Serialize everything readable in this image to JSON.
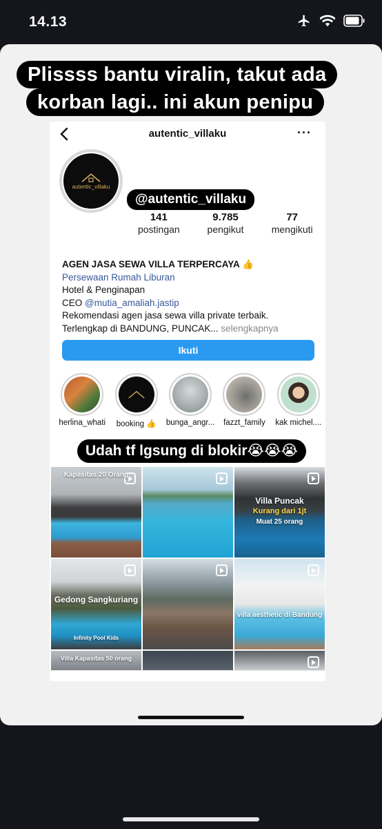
{
  "status_bar": {
    "time": "14.13",
    "icons": [
      "airplane-icon",
      "wifi-icon",
      "battery-icon"
    ]
  },
  "caption": {
    "line1": "Plissss bantu viralin, takut ada",
    "line2": "korban lagi.. ini akun penipu"
  },
  "profile": {
    "username": "autentic_villaku",
    "handle_tag": "@autentic_villaku",
    "avatar_text": "autentic_villaku",
    "stats": [
      {
        "value": "141",
        "label": "postingan"
      },
      {
        "value": "9.785",
        "label": "pengikut"
      },
      {
        "value": "77",
        "label": "mengikuti"
      }
    ],
    "bio": {
      "title": "AGEN JASA SEWA VILLA TERPERCAYA 👍",
      "category": "Persewaan Rumah Liburan",
      "line3": "Hotel & Penginapan",
      "ceo_prefix": "CEO ",
      "ceo_mention": "@mutia_amaliah.jastip",
      "line5": "Rekomendasi agen jasa sewa villa  private terbaik.",
      "line6": "Terlengkap di BANDUNG, PUNCAK...",
      "more": " selengkapnya"
    },
    "follow_label": "Ikuti"
  },
  "highlights": [
    {
      "label": "herlina_whati"
    },
    {
      "label": "booking 👍"
    },
    {
      "label": "bunga_angr..."
    },
    {
      "label": "fazzt_family"
    },
    {
      "label": "kak michel...."
    }
  ],
  "banner2": "Udah tf lgsung di blokir😭😭😭",
  "grid": [
    {
      "overlay": "Kapasitas 20 Orang"
    },
    {
      "overlay": ""
    },
    {
      "overlay": "Villa Puncak",
      "overlay2": "Kurang dari 1jt",
      "overlay3": "Muat 25 orang"
    },
    {
      "overlay": "Gedong Sangkuriang",
      "overlay2": "Infinity Pool Kids"
    },
    {
      "overlay": ""
    },
    {
      "overlay": "villa aesthetic di Bandung"
    },
    {
      "overlay": "Villa Kapasitas 50 orang"
    },
    {
      "overlay": ""
    },
    {
      "overlay": ""
    }
  ],
  "colors": {
    "follow_button": "#2a9af1",
    "link": "#385898",
    "notification_dot": "#e0245e"
  }
}
